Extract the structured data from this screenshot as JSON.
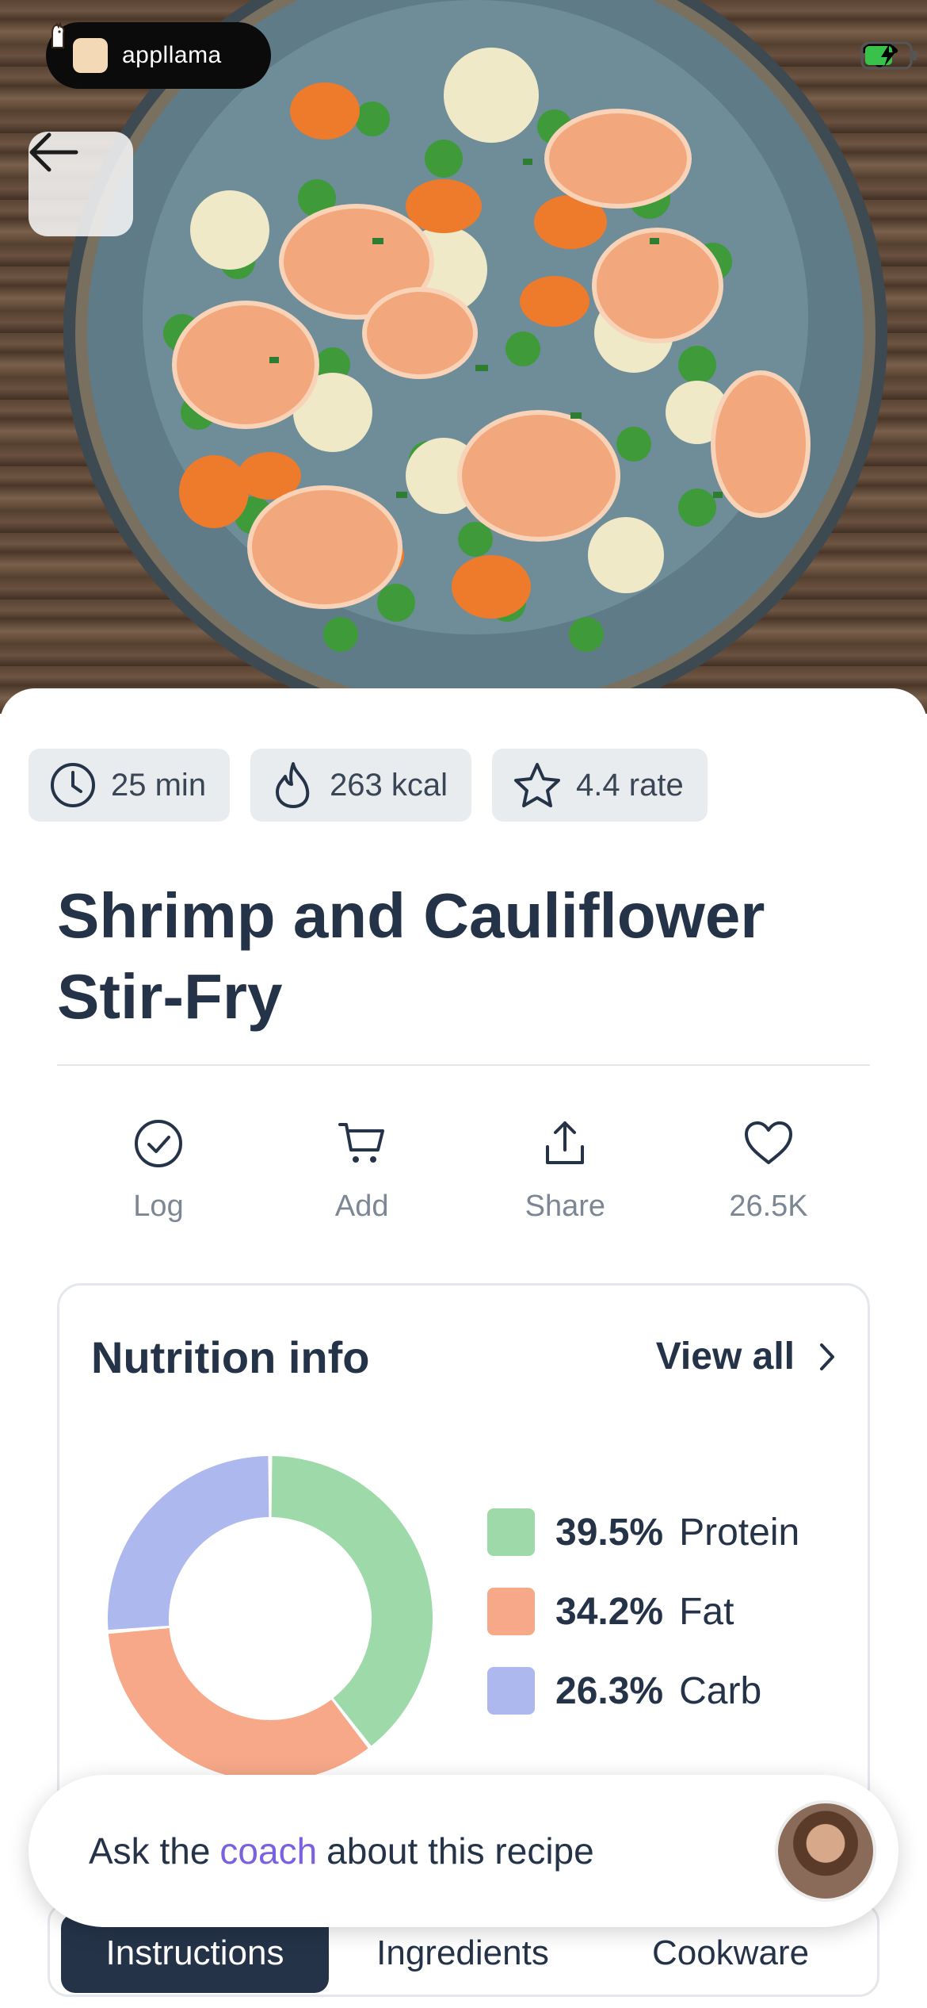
{
  "status_bar": {
    "brand": "appllama",
    "icons": [
      "wifi-icon",
      "battery-charging-icon"
    ]
  },
  "hero": {
    "alt_subject": ""
  },
  "recipe": {
    "stats": [
      {
        "icon": "clock-icon",
        "label": "25 min"
      },
      {
        "icon": "flame-icon",
        "label": "263 kcal"
      },
      {
        "icon": "star-icon",
        "label": "4.4 rate"
      }
    ],
    "title": "Shrimp and Cauliflower Stir-Fry"
  },
  "actions": [
    {
      "icon": "check-circle-icon",
      "label": "Log"
    },
    {
      "icon": "cart-icon",
      "label": "Add"
    },
    {
      "icon": "share-icon",
      "label": "Share"
    },
    {
      "icon": "heart-icon",
      "label": "26.5K"
    }
  ],
  "nutrition": {
    "title": "Nutrition info",
    "view_all": "View all"
  },
  "chart_data": {
    "type": "pie",
    "donut": true,
    "title": "",
    "series": [
      {
        "name": "Protein",
        "value": 39.5,
        "label": "39.5%",
        "color": "#9dd9a9"
      },
      {
        "name": "Fat",
        "value": 34.2,
        "label": "34.2%",
        "color": "#f6a889"
      },
      {
        "name": "Carb",
        "value": 26.3,
        "label": "26.3%",
        "color": "#adb8ee"
      }
    ]
  },
  "tabs": [
    {
      "label": "Instructions",
      "active": true
    },
    {
      "label": "Ingredients",
      "active": false
    },
    {
      "label": "Cookware",
      "active": false
    }
  ],
  "coach": {
    "prefix": "Ask the",
    "accent": "coach",
    "suffix": "about this recipe",
    "accent_color": "#7b61e0"
  }
}
